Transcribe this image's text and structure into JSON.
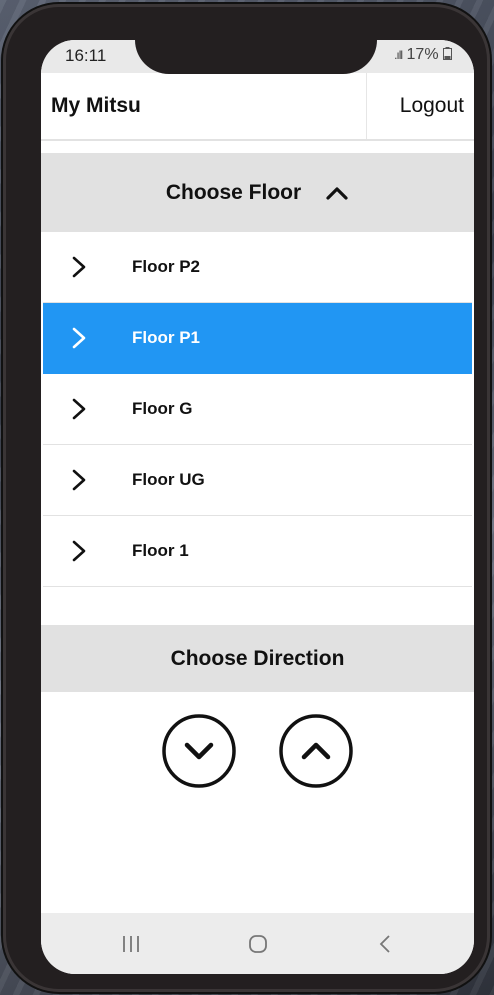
{
  "status_bar": {
    "time": "16:11",
    "signal": ".ıll",
    "battery": "17%"
  },
  "header": {
    "title": "My Mitsu",
    "logout_label": "Logout"
  },
  "floor_section": {
    "title": "Choose Floor",
    "items": [
      {
        "label": "Floor P2"
      },
      {
        "label": "Floor P1"
      },
      {
        "label": "Floor G"
      },
      {
        "label": "Floor UG"
      },
      {
        "label": "Floor 1"
      }
    ],
    "selected": "Floor P1"
  },
  "direction_section": {
    "title": "Choose Direction"
  },
  "icons": {
    "collapse": "chevron-up-icon",
    "floor_item": "chevron-right-icon",
    "down": "down-circle-icon",
    "up": "up-circle-icon",
    "recent": "recent-apps-icon",
    "home": "home-icon",
    "back": "back-icon"
  },
  "colors": {
    "accent": "#2196f3",
    "section_bg": "#e1e1e1",
    "phone_frame": "#231f20"
  }
}
